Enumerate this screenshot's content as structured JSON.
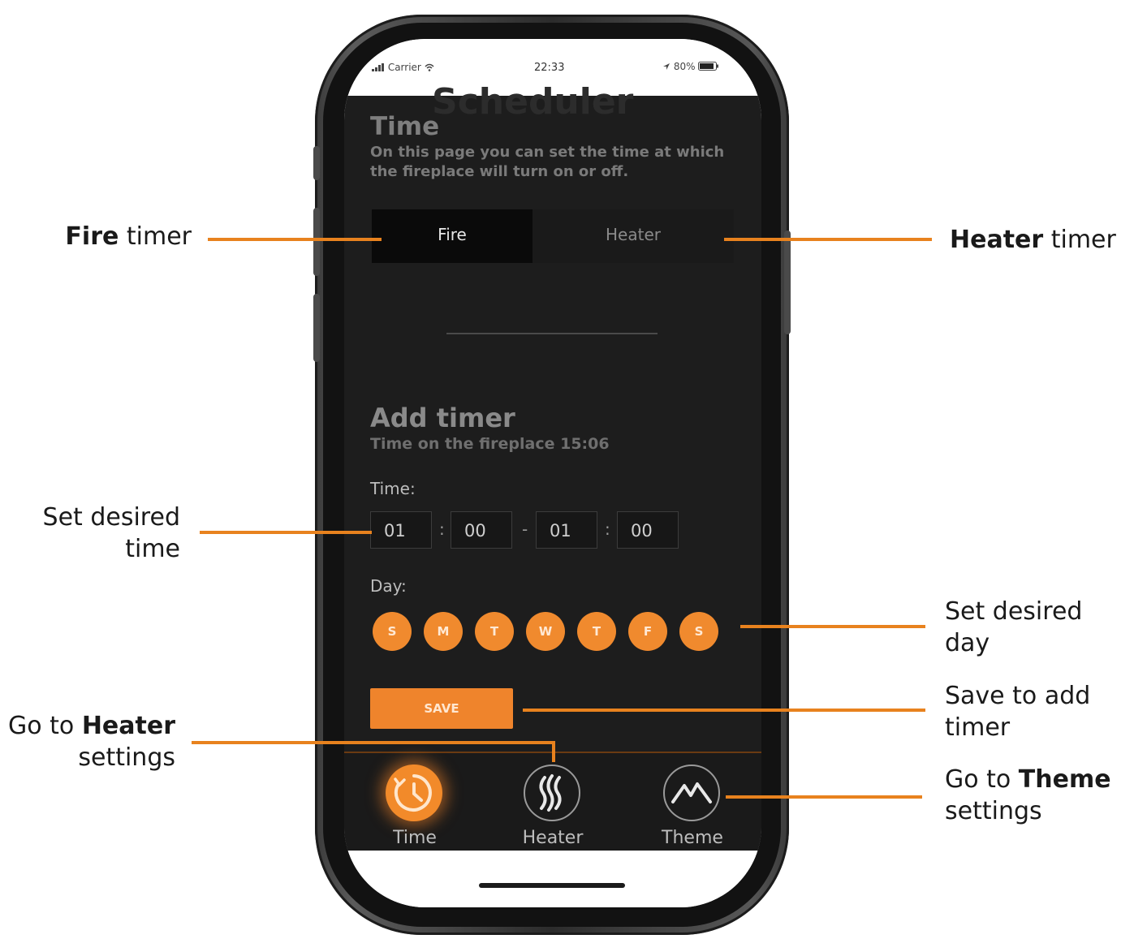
{
  "status_bar": {
    "carrier": "Carrier",
    "time": "22:33",
    "battery": "80%"
  },
  "page": {
    "ghost_title": "Scheduler",
    "title": "Time",
    "description": "On this page you can set the time at which the fireplace will turn on or off."
  },
  "tabs": {
    "fire": "Fire",
    "heater": "Heater"
  },
  "add_timer": {
    "title": "Add timer",
    "subtitle": "Time on the fireplace 15:06",
    "time_label": "Time:",
    "time_values": [
      "01",
      "00",
      "01",
      "00"
    ],
    "separator_colon": ":",
    "separator_dash": "-",
    "day_label": "Day:",
    "days": [
      "S",
      "M",
      "T",
      "W",
      "T",
      "F",
      "S"
    ],
    "save_label": "SAVE"
  },
  "nav": {
    "time": "Time",
    "heater": "Heater",
    "theme": "Theme"
  },
  "annotations": {
    "fire_timer": {
      "bold": "Fire",
      "rest": " timer"
    },
    "heater_timer": {
      "bold": "Heater",
      "rest": " timer"
    },
    "set_time": [
      "Set desired",
      "time"
    ],
    "set_day": [
      "Set desired",
      "day"
    ],
    "save_add": [
      "Save to add",
      "timer"
    ],
    "go_heater": {
      "pre": "Go to ",
      "bold": "Heater",
      "line2": "settings"
    },
    "go_theme": {
      "pre": "Go to ",
      "bold": "Theme",
      "line2": "settings"
    }
  },
  "colors": {
    "accent": "#ef842c",
    "screen_bg": "#1d1d1d",
    "annotation_line": "#e8821e"
  },
  "icons": {
    "time": "clock-icon",
    "heater": "flame-icon",
    "theme": "mountain-icon",
    "signal": "signal-icon",
    "wifi": "wifi-icon",
    "battery": "battery-icon",
    "location": "location-arrow-icon"
  }
}
